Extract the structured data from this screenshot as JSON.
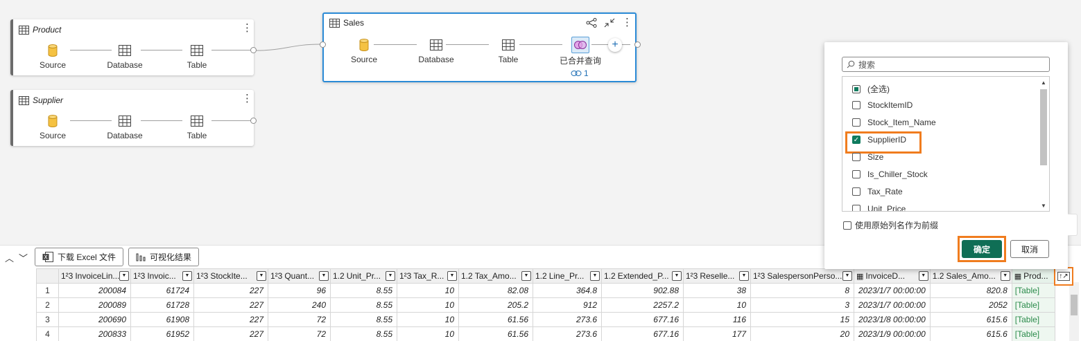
{
  "queries": [
    {
      "name": "Product",
      "steps": [
        "Source",
        "Database",
        "Table"
      ]
    },
    {
      "name": "Supplier",
      "steps": [
        "Source",
        "Database",
        "Table"
      ]
    },
    {
      "name": "Sales",
      "steps": [
        "Source",
        "Database",
        "Table",
        "已合并查询"
      ],
      "link_count": "1"
    }
  ],
  "icons": {
    "table": "table-icon",
    "source": "cylinder-icon",
    "database": "grid-icon",
    "merge": "venn-icon",
    "share": "share-icon",
    "collapse": "collapse-icon",
    "more": "more-vertical-icon",
    "add": "plus-icon",
    "link": "link-icon",
    "search": "search-icon",
    "excel": "excel-icon",
    "chart": "bar-chart-icon",
    "expand": "expand-column-icon"
  },
  "toolbar": {
    "download_excel": "下载 Excel 文件",
    "visualize": "可视化结果"
  },
  "grid": {
    "columns": [
      {
        "type": "1²3",
        "label": "InvoiceLin..."
      },
      {
        "type": "1²3",
        "label": "Invoic..."
      },
      {
        "type": "1²3",
        "label": "StockIte..."
      },
      {
        "type": "1²3",
        "label": "Quant..."
      },
      {
        "type": "1.2",
        "label": "Unit_Pr..."
      },
      {
        "type": "1²3",
        "label": "Tax_R..."
      },
      {
        "type": "1.2",
        "label": "Tax_Amo..."
      },
      {
        "type": "1.2",
        "label": "Line_Pr..."
      },
      {
        "type": "1.2",
        "label": "Extended_P..."
      },
      {
        "type": "1²3",
        "label": "Reselle..."
      },
      {
        "type": "1²3",
        "label": "SalespersonPerso..."
      },
      {
        "type": "date",
        "label": "InvoiceD..."
      },
      {
        "type": "1.2",
        "label": "Sales_Amo..."
      },
      {
        "type": "table",
        "label": "Prod..."
      }
    ],
    "rows": [
      [
        "1",
        "200084",
        "61724",
        "227",
        "96",
        "8.55",
        "10",
        "82.08",
        "364.8",
        "902.88",
        "38",
        "8",
        "2023/1/7 00:00:00",
        "820.8",
        "[Table]"
      ],
      [
        "2",
        "200089",
        "61728",
        "227",
        "240",
        "8.55",
        "10",
        "205.2",
        "912",
        "2257.2",
        "10",
        "3",
        "2023/1/7 00:00:00",
        "2052",
        "[Table]"
      ],
      [
        "3",
        "200690",
        "61908",
        "227",
        "72",
        "8.55",
        "10",
        "61.56",
        "273.6",
        "677.16",
        "116",
        "15",
        "2023/1/8 00:00:00",
        "615.6",
        "[Table]"
      ],
      [
        "4",
        "200833",
        "61952",
        "227",
        "72",
        "8.55",
        "10",
        "61.56",
        "273.6",
        "677.16",
        "177",
        "20",
        "2023/1/9 00:00:00",
        "615.6",
        "[Table]"
      ]
    ]
  },
  "column_picker": {
    "search_placeholder": "搜索",
    "options": [
      {
        "label": "(全选)",
        "state": "partial"
      },
      {
        "label": "StockItemID",
        "state": "unchecked"
      },
      {
        "label": "Stock_Item_Name",
        "state": "unchecked"
      },
      {
        "label": "SupplierID",
        "state": "checked"
      },
      {
        "label": "Size",
        "state": "unchecked"
      },
      {
        "label": "Is_Chiller_Stock",
        "state": "unchecked"
      },
      {
        "label": "Tax_Rate",
        "state": "unchecked"
      },
      {
        "label": "Unit_Price",
        "state": "unchecked"
      }
    ],
    "prefix_label": "使用原始列名作为前缀",
    "ok": "确定",
    "cancel": "取消"
  },
  "colors": {
    "accent_blue": "#2a8ad6",
    "highlight_orange": "#f07c1e",
    "primary_green": "#0f6e55"
  }
}
